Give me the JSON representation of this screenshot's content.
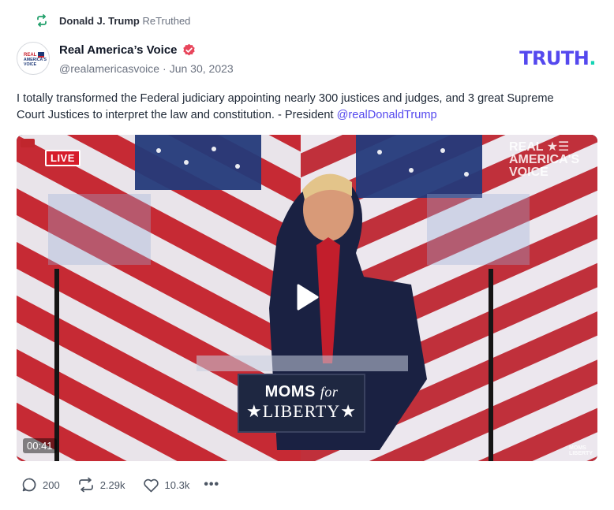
{
  "retruth": {
    "name": "Donald J. Trump",
    "verb": "ReTruthed",
    "icon": "retruth-icon"
  },
  "account": {
    "name": "Real America’s Voice",
    "handle": "@realamericasvoice",
    "separator": "·",
    "date": "Jun 30, 2023",
    "avatar_text_lines": [
      "REAL",
      "AMERICA'S",
      "VOICE"
    ],
    "verified_color": "#e8455b"
  },
  "brand": {
    "logo_text": "TRUTH",
    "logo_dot": ".",
    "primary_color": "#5448ee",
    "dot_color": "#14d4b4"
  },
  "post": {
    "text": "I totally transformed the Federal judiciary appointing nearly 300 justices and judges, and 3 great Supreme Court Justices to interpret the law and constitution. - President ",
    "mention": "@realDonaldTrump"
  },
  "video": {
    "live_badge": "LIVE",
    "watermark_lines": [
      "REAL ★☰",
      "AMERICA'S",
      "VOICE"
    ],
    "duration": "00:41",
    "podium_line1_a": "MOMS",
    "podium_line1_b": "for",
    "podium_line2": "★LIBERTY★",
    "corner_mark_lines": [
      "MOMS",
      "LIBERTY"
    ]
  },
  "actions": {
    "replies": "200",
    "retruths": "2.29k",
    "likes": "10.3k",
    "more": "•••"
  }
}
